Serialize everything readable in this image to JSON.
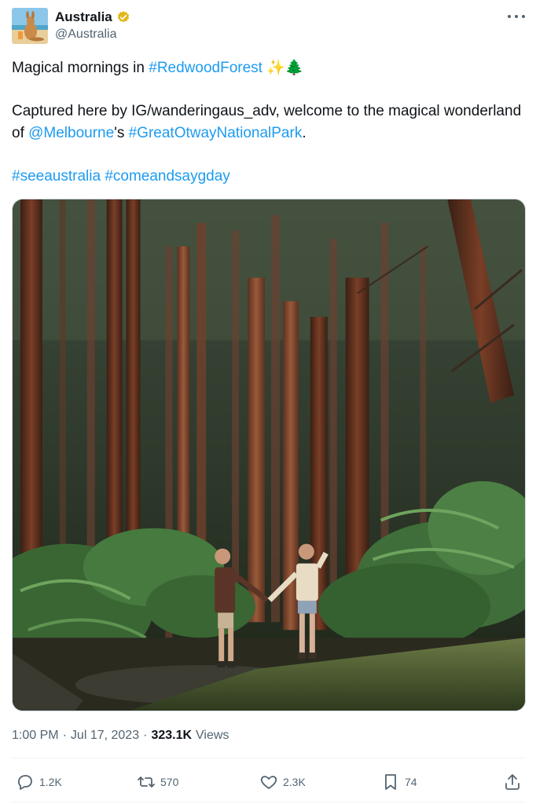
{
  "author": {
    "display_name": "Australia",
    "handle": "@Australia",
    "verified": true,
    "verified_color": "#e2b719"
  },
  "tweet": {
    "line1_text": "Magical mornings in ",
    "line1_hashtag": "#RedwoodForest",
    "line1_emoji": "✨🌲",
    "para2_prefix": "Captured here by IG/wanderingaus_adv, welcome to the magical wonderland of ",
    "para2_mention": "@Melbourne",
    "para2_middle": "'s ",
    "para2_hashtag": "#GreatOtwayNationalPark",
    "para2_suffix": ".",
    "hashtag_1": "#seeaustralia",
    "hashtag_2": "#comeandsaygday"
  },
  "meta": {
    "time": "1:00 PM",
    "separator": "·",
    "date": "Jul 17, 2023",
    "views_count": "323.1K",
    "views_label": "Views"
  },
  "actions": {
    "replies": "1.2K",
    "reposts": "570",
    "likes": "2.3K",
    "bookmarks": "74"
  },
  "colors": {
    "link": "#1d9bf0",
    "secondary_text": "#536471",
    "primary_text": "#0f1419"
  },
  "icons": {
    "reply": "reply-icon",
    "repost": "repost-icon",
    "like": "heart-icon",
    "bookmark": "bookmark-icon",
    "share": "share-icon",
    "more": "more-icon"
  }
}
